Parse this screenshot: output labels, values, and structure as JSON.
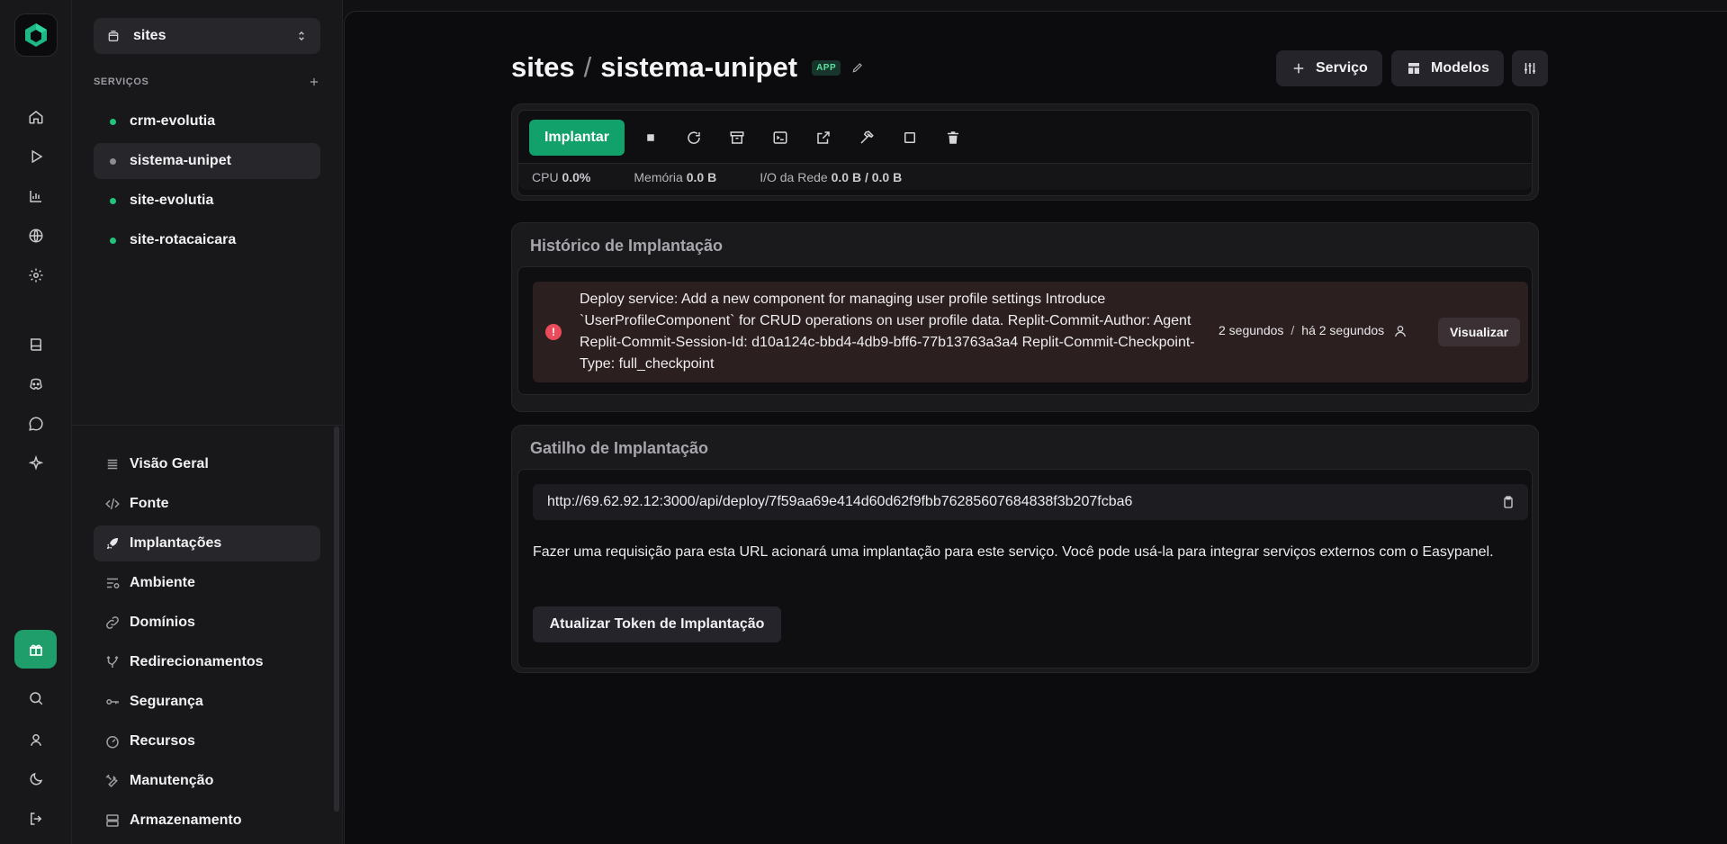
{
  "project": {
    "name": "sites"
  },
  "services": {
    "heading": "SERVIÇOS",
    "items": [
      {
        "label": "crm-evolutia",
        "status": "running"
      },
      {
        "label": "sistema-unipet",
        "status": "stopped"
      },
      {
        "label": "site-evolutia",
        "status": "running"
      },
      {
        "label": "site-rotacaicara",
        "status": "running"
      }
    ]
  },
  "nav": {
    "items": [
      {
        "label": "Visão Geral",
        "icon": "list-icon"
      },
      {
        "label": "Fonte",
        "icon": "code-icon"
      },
      {
        "label": "Implantações",
        "icon": "rocket-icon"
      },
      {
        "label": "Ambiente",
        "icon": "env-icon"
      },
      {
        "label": "Domínios",
        "icon": "link-icon"
      },
      {
        "label": "Redirecionamentos",
        "icon": "redirect-icon"
      },
      {
        "label": "Segurança",
        "icon": "key-icon"
      },
      {
        "label": "Recursos",
        "icon": "gauge-icon"
      },
      {
        "label": "Manutenção",
        "icon": "tools-icon"
      },
      {
        "label": "Armazenamento",
        "icon": "storage-icon"
      }
    ]
  },
  "header": {
    "project": "sites",
    "separator": "/",
    "service": "sistema-unipet",
    "badge": "APP",
    "service_button": "Serviço",
    "templates_button": "Modelos"
  },
  "toolbar": {
    "deploy_label": "Implantar"
  },
  "stats": {
    "cpu_label": "CPU",
    "cpu_value": "0.0%",
    "memory_label": "Memória",
    "memory_value": "0.0 B",
    "network_label": "I/O da Rede",
    "network_value": "0.0 B / 0.0 B"
  },
  "history": {
    "title": "Histórico de Implantação",
    "entry": {
      "message": "Deploy service: Add a new component for managing user profile settings Introduce `UserProfileComponent` for CRUD operations on user profile data. Replit-Commit-Author: Agent Replit-Commit-Session-Id: d10a124c-bbd4-4db9-bff6-77b13763a3a4 Replit-Commit-Checkpoint-Type: full_checkpoint",
      "duration": "2 segundos",
      "separator": "/",
      "ago": "há 2 segundos",
      "view_label": "Visualizar",
      "status_color": "#e94b5b"
    }
  },
  "trigger": {
    "title": "Gatilho de Implantação",
    "url": "http://69.62.92.12:3000/api/deploy/7f59aa69e414d60d62f9fbb76285607684838f3b207fcba6",
    "description": "Fazer uma requisição para esta URL acionará uma implantação para este serviço. Você pode usá-la para integrar serviços externos com o Easypanel.",
    "regenerate_label": "Atualizar Token de Implantação"
  },
  "colors": {
    "accent": "#12a06b",
    "running_dot": "#22c47c",
    "stopped_dot": "#8d8d92"
  }
}
